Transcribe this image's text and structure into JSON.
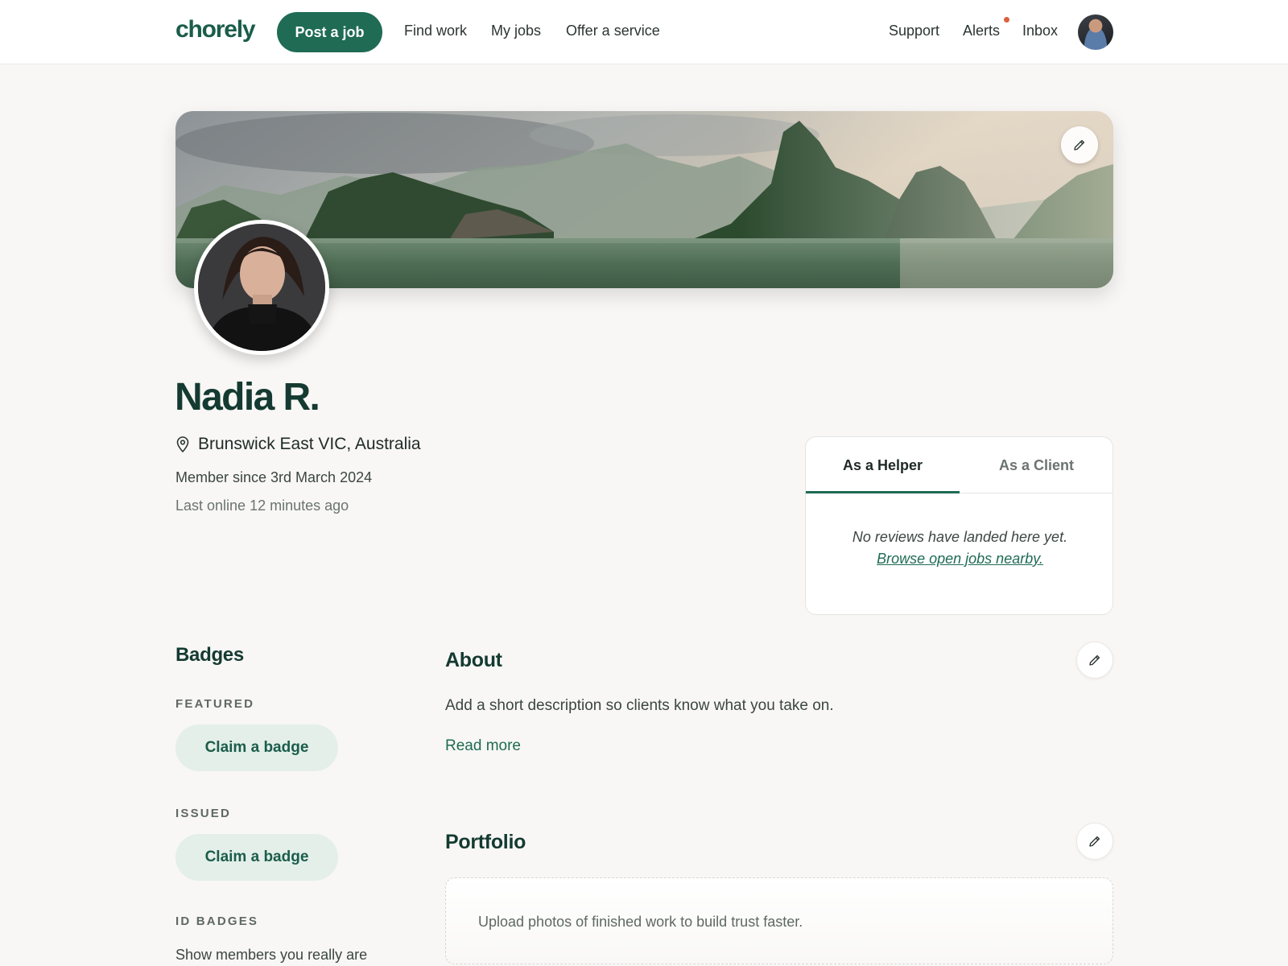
{
  "header": {
    "logo": "chorely",
    "post_job": "Post a job",
    "nav": [
      "Find work",
      "My jobs",
      "Offer a service"
    ],
    "support": "Support",
    "alerts": "Alerts",
    "inbox": "Inbox"
  },
  "profile": {
    "name": "Nadia R.",
    "location": "Brunswick East VIC, Australia",
    "member_since": "Member since 3rd March 2024",
    "last_online": "Last online 12 minutes ago"
  },
  "reviews": {
    "tabs": [
      "As a Helper",
      "As a Client"
    ],
    "active_tab": "As a Helper",
    "empty_text": "No reviews have landed here yet.",
    "link_text": "Browse open jobs nearby."
  },
  "badges": {
    "title": "Badges",
    "featured_label": "FEATURED",
    "featured_button": "Claim a badge",
    "issued_label": "ISSUED",
    "issued_button": "Claim a badge",
    "id_label": "ID BADGES",
    "id_desc": "Show members you really are"
  },
  "about": {
    "title": "About",
    "text": "Add a short description so clients know what you take on.",
    "read_more": "Read more"
  },
  "portfolio": {
    "title": "Portfolio",
    "empty_text": "Upload photos of finished work to build trust faster."
  },
  "colors": {
    "brand": "#1f6b54",
    "brand_light": "#e4efea",
    "alert_dot": "#d9623f",
    "background": "#f8f7f5"
  },
  "icons": [
    "pencil-icon",
    "location-pin-icon"
  ]
}
